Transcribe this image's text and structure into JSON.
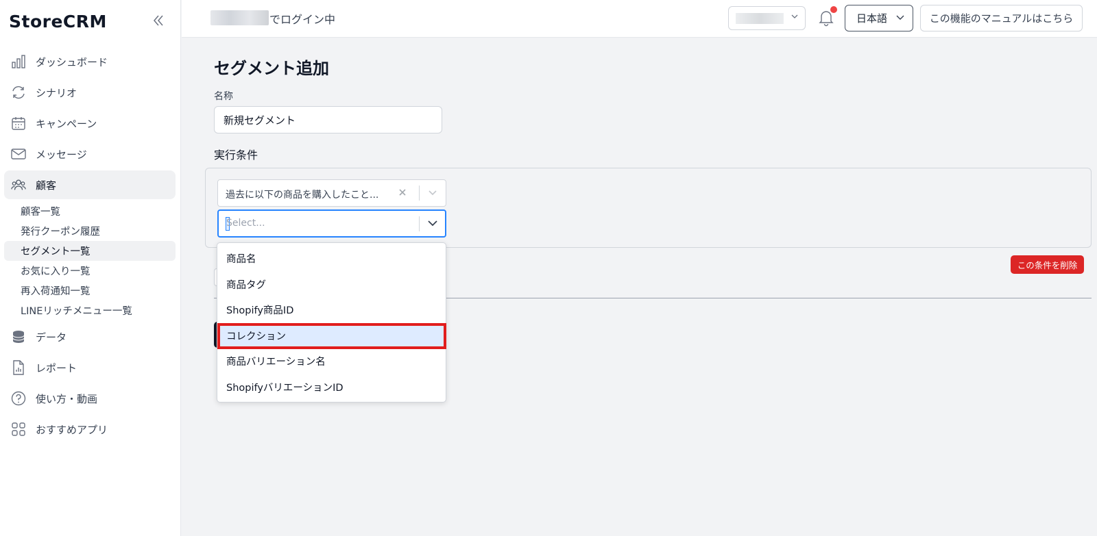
{
  "sidebar": {
    "logo": "StoreCRM",
    "collapse_icon": "double-chevron-left-icon",
    "items": [
      {
        "label": "ダッシュボード",
        "icon": "bar-chart-icon"
      },
      {
        "label": "シナリオ",
        "icon": "refresh-icon"
      },
      {
        "label": "キャンペーン",
        "icon": "calendar-icon"
      },
      {
        "label": "メッセージ",
        "icon": "mail-icon"
      },
      {
        "label": "顧客",
        "icon": "users-icon"
      },
      {
        "label": "データ",
        "icon": "database-icon"
      },
      {
        "label": "レポート",
        "icon": "document-chart-icon"
      },
      {
        "label": "使い方・動画",
        "icon": "question-circle-icon"
      },
      {
        "label": "おすすめアプリ",
        "icon": "apps-grid-icon"
      }
    ],
    "customer_sub": [
      {
        "label": "顧客一覧"
      },
      {
        "label": "発行クーポン履歴"
      },
      {
        "label": "セグメント一覧"
      },
      {
        "label": "お気に入り一覧"
      },
      {
        "label": "再入荷通知一覧"
      },
      {
        "label": "LINEリッチメニュー一覧"
      }
    ]
  },
  "header": {
    "login_suffix": "でログイン中",
    "language": "日本語",
    "manual_button": "この機能のマニュアルはこちら",
    "notification_icon": "bell-icon",
    "accent_dot_color": "#ef4444"
  },
  "main": {
    "title": "セグメント追加",
    "name_label": "名称",
    "name_value": "新規セグメント",
    "conditions_label": "実行条件",
    "condition_select_value": "過去に以下の商品を購入したこと...",
    "subselect_placeholder": "Select...",
    "delete_condition_button": "この条件を削除",
    "dropdown_options": [
      {
        "label": "商品名"
      },
      {
        "label": "商品タグ"
      },
      {
        "label": "Shopify商品ID"
      },
      {
        "label": "コレクション"
      },
      {
        "label": "商品バリエーション名"
      },
      {
        "label": "ShopifyバリエーションID"
      }
    ],
    "highlight_color": "#e11d1d",
    "focus_color": "#2684ff",
    "danger_color": "#dc2626"
  }
}
